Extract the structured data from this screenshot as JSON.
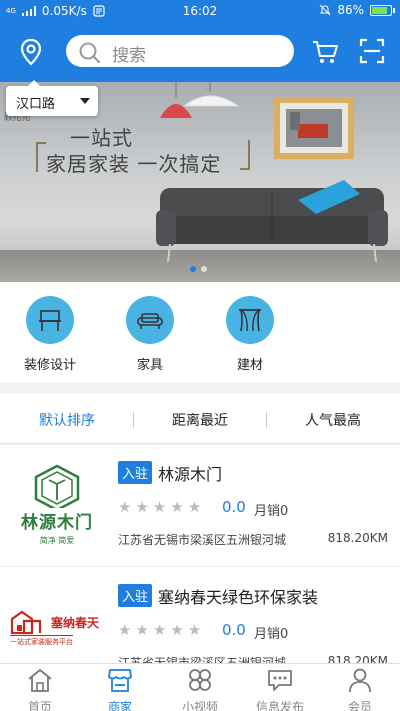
{
  "status_bar": {
    "network": "4G",
    "speed": "0.05K/s",
    "time": "16:02",
    "battery": "86%",
    "battery_level": 0.86
  },
  "header": {
    "search_placeholder": "搜索"
  },
  "location": {
    "current": "汉口路"
  },
  "banner": {
    "brand": "顾抢抢",
    "slogan_line1": "一站式",
    "slogan_line2": "家居家装 一次搞定",
    "slide_count": 2,
    "active_slide": 0
  },
  "categories": [
    {
      "label": "装修设计",
      "icon": "desk-icon"
    },
    {
      "label": "家具",
      "icon": "sofa-icon"
    },
    {
      "label": "建材",
      "icon": "curtain-icon"
    }
  ],
  "sort_tabs": [
    {
      "label": "默认排序",
      "active": true
    },
    {
      "label": "距离最近",
      "active": false
    },
    {
      "label": "人气最高",
      "active": false
    }
  ],
  "shops": [
    {
      "badge": "入驻",
      "name": "林源木门",
      "logo_text": "林源木门",
      "logo_sub": "简净 简爱",
      "rating": 0.0,
      "score": "0.0",
      "sales": "月销0",
      "address": "江苏省无锡市梁溪区五洲银河城",
      "distance": "818.20KM"
    },
    {
      "badge": "入驻",
      "name": "塞纳春天绿色环保家装",
      "logo_text": "塞纳春天",
      "logo_sub": "一站式家装服务平台",
      "rating": 0.0,
      "score": "0.0",
      "sales": "月销0",
      "address": "江苏省无锡市梁溪区五洲银河城",
      "distance": "818.20KM"
    }
  ],
  "bottom_nav": [
    {
      "label": "首页",
      "icon": "home-icon",
      "active": false
    },
    {
      "label": "商家",
      "icon": "store-icon",
      "active": true
    },
    {
      "label": "小视频",
      "icon": "video-icon",
      "active": false
    },
    {
      "label": "信息发布",
      "icon": "message-icon",
      "active": false
    },
    {
      "label": "会员",
      "icon": "user-icon",
      "active": false
    }
  ],
  "colors": {
    "primary": "#1f7fe0",
    "category_circle": "#49b3e4",
    "logo_green": "#2e7d3a",
    "logo_red": "#c8261e"
  }
}
